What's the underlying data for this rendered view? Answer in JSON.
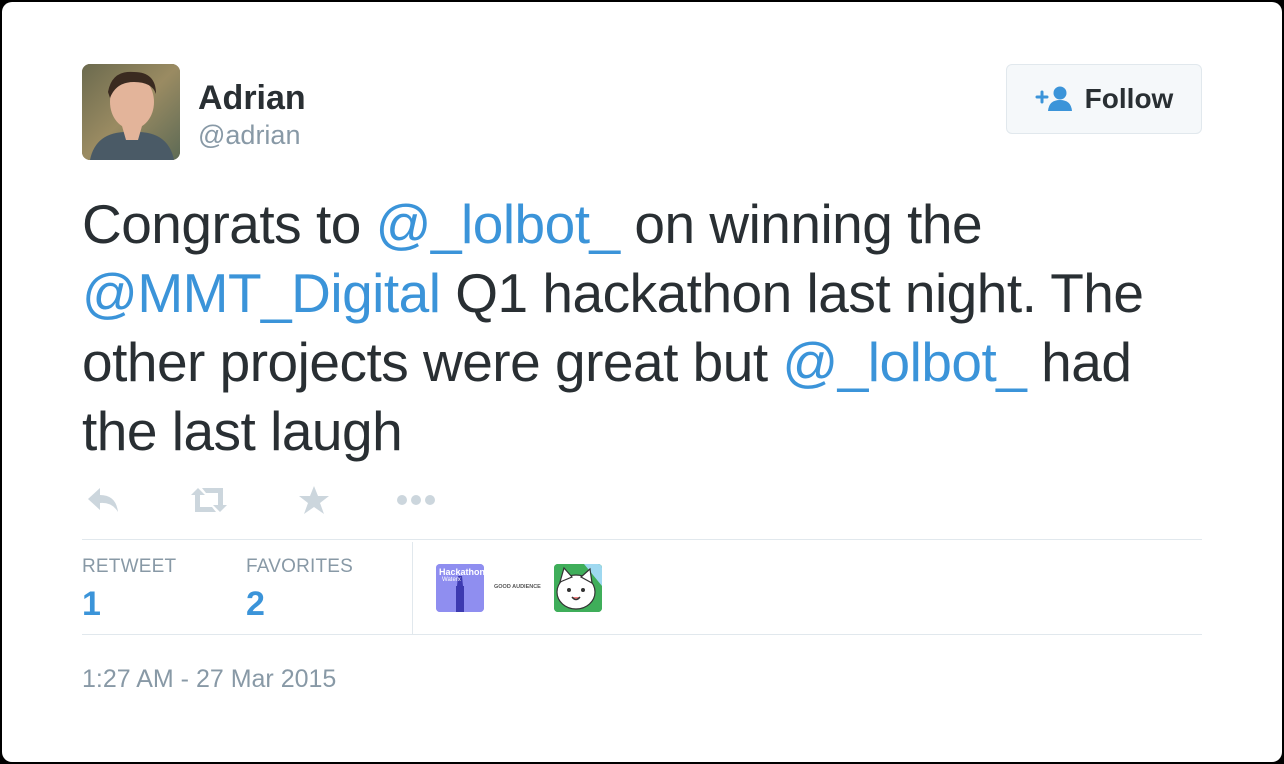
{
  "user": {
    "name": "Adrian",
    "handle": "@adrian"
  },
  "follow_button": {
    "label": "Follow",
    "icon": "add-user-icon"
  },
  "tweet": {
    "segments": [
      {
        "text": "Congrats to ",
        "type": "text"
      },
      {
        "text": "@_lolbot_",
        "type": "mention"
      },
      {
        "text": " on winning the ",
        "type": "text"
      },
      {
        "text": "@MMT_Digital",
        "type": "mention"
      },
      {
        "text": " Q1 hackathon last night. The other projects were great but ",
        "type": "text"
      },
      {
        "text": "@_lolbot_",
        "type": "mention"
      },
      {
        "text": " had the last laugh",
        "type": "text"
      }
    ]
  },
  "actions": {
    "reply_icon": "reply-icon",
    "retweet_icon": "retweet-icon",
    "favorite_icon": "star-icon",
    "more_icon": "more-dots-icon"
  },
  "stats": {
    "retweet_label": "RETWEET",
    "retweet_count": "1",
    "favorites_label": "FAVORITES",
    "favorites_count": "2"
  },
  "favoriters": {
    "hackathon_badge_text": "Hackathon",
    "hackathon_badge_sub": "Waterx",
    "good_audience_text": "GOOD AUDIENCE"
  },
  "timestamp": "1:27 AM - 27 Mar 2015",
  "colors": {
    "link": "#3b94d9",
    "text": "#292f33",
    "muted": "#8899a6",
    "border": "#e1e8ed"
  }
}
